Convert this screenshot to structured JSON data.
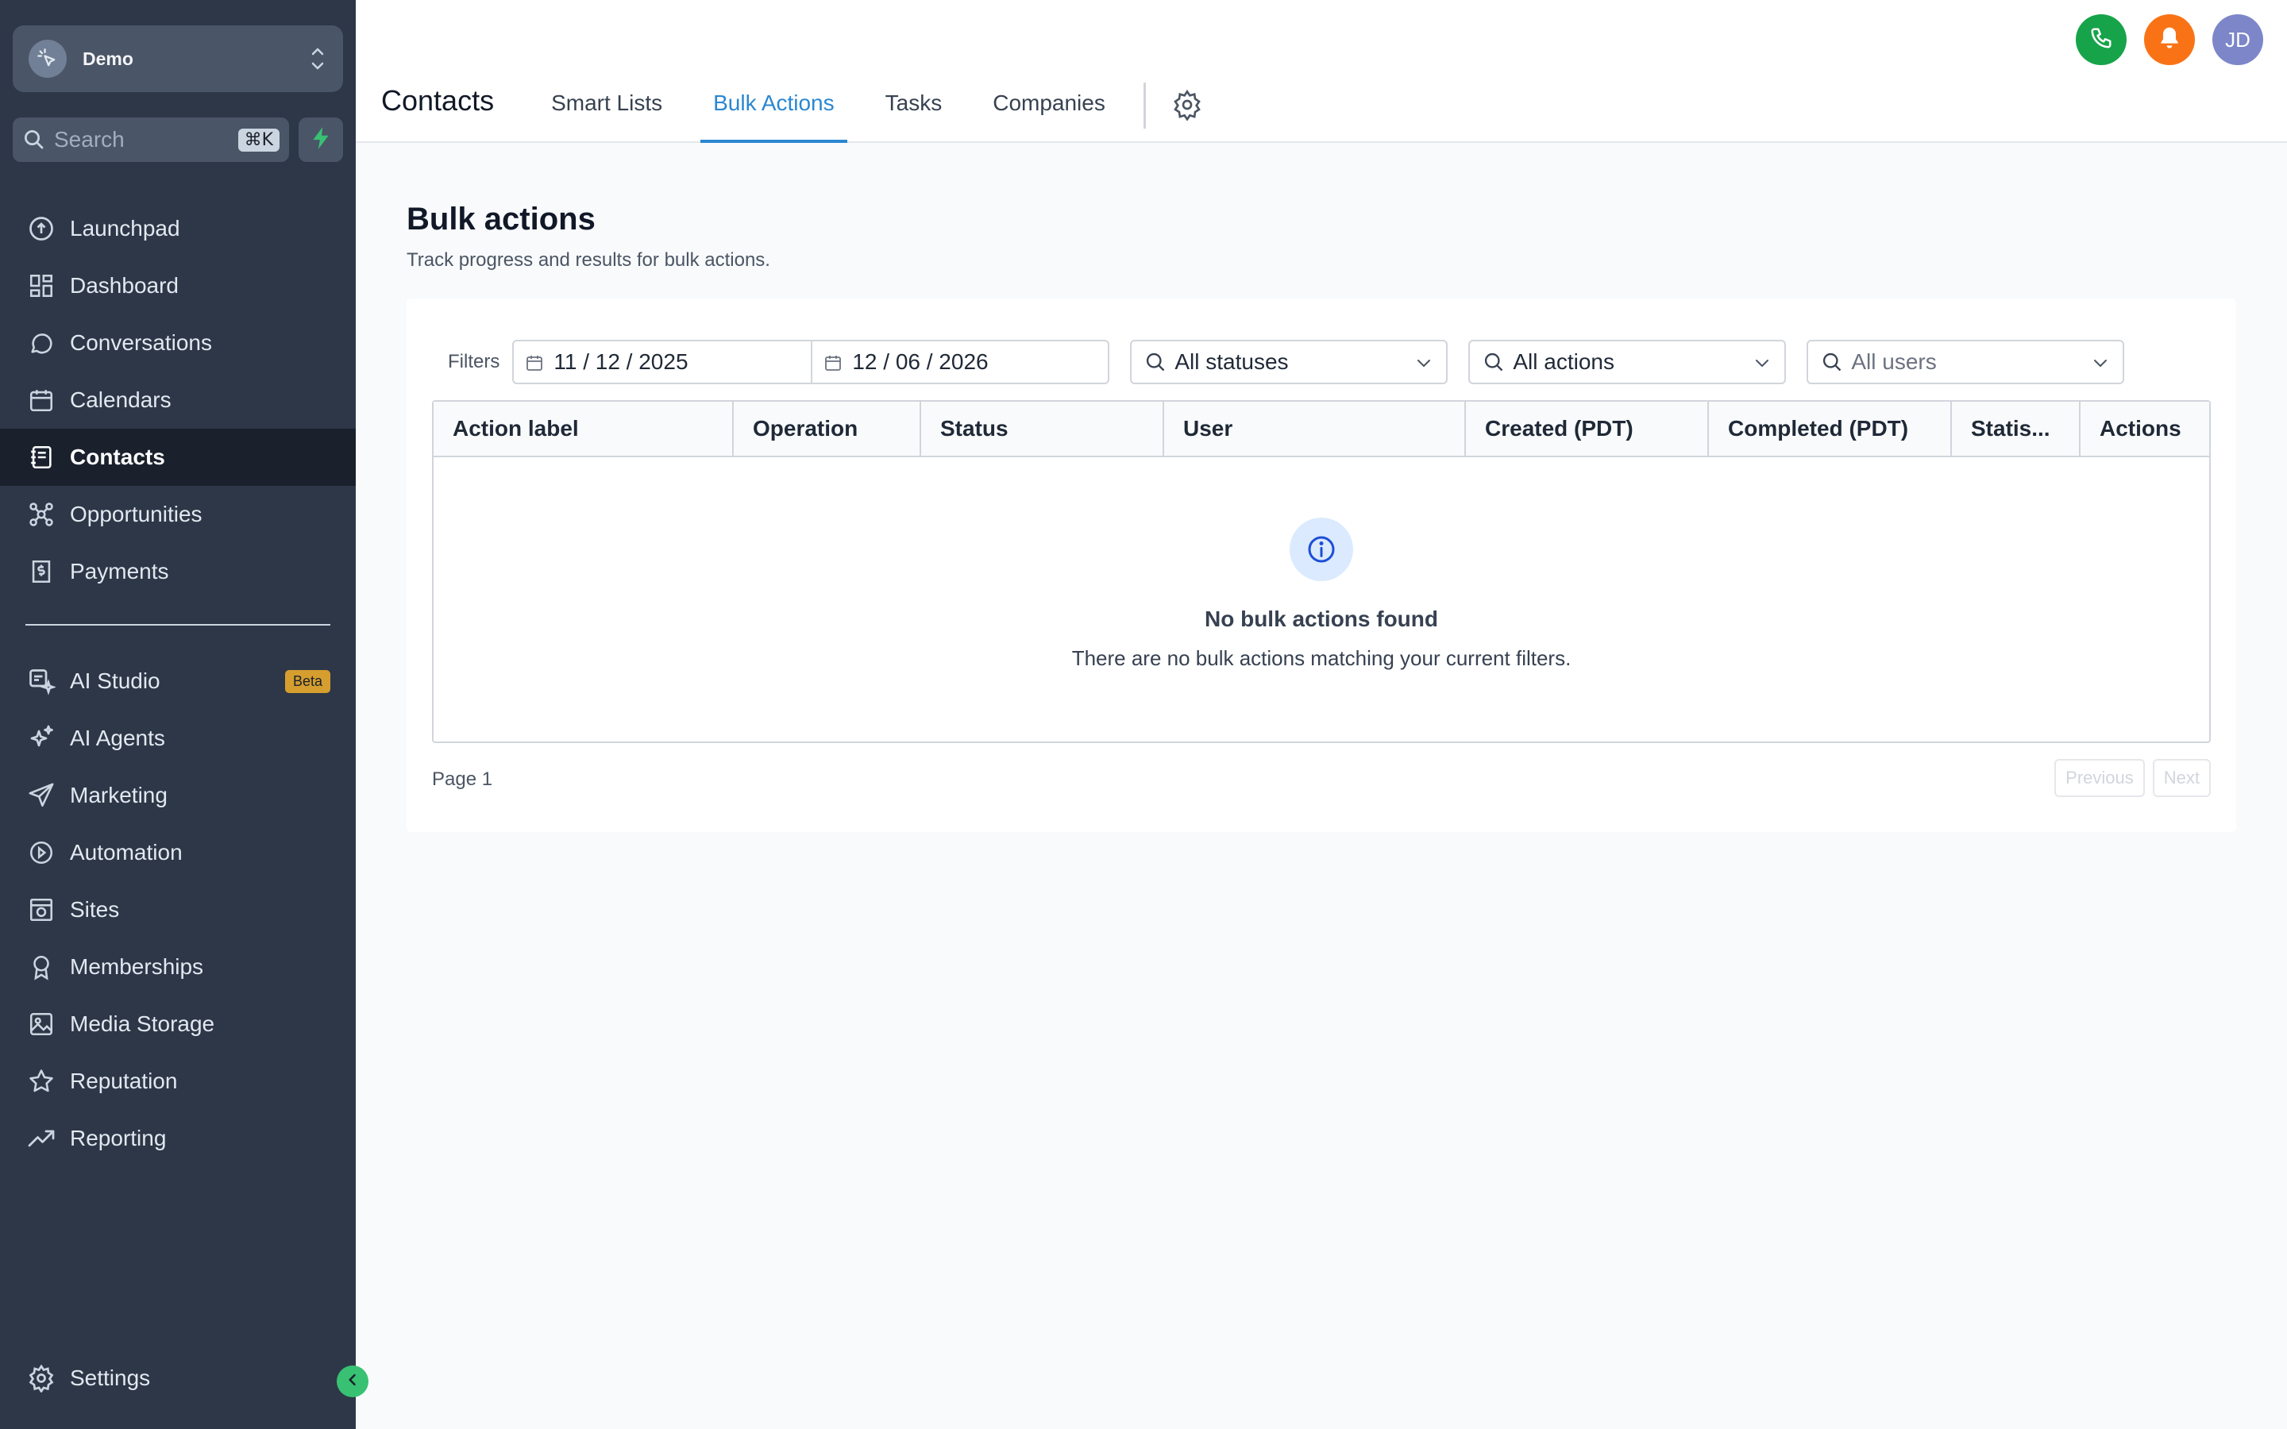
{
  "sidebar": {
    "account": {
      "name": "Demo"
    },
    "search": {
      "placeholder": "Search",
      "shortcut": "⌘K"
    },
    "items_primary": [
      {
        "label": "Launchpad",
        "icon": "launchpad-icon"
      },
      {
        "label": "Dashboard",
        "icon": "dashboard-icon"
      },
      {
        "label": "Conversations",
        "icon": "chat-icon"
      },
      {
        "label": "Calendars",
        "icon": "calendar-icon"
      },
      {
        "label": "Contacts",
        "icon": "contacts-icon",
        "active": true
      },
      {
        "label": "Opportunities",
        "icon": "opportunities-icon"
      },
      {
        "label": "Payments",
        "icon": "payments-icon"
      }
    ],
    "items_secondary": [
      {
        "label": "AI Studio",
        "icon": "ai-studio-icon",
        "badge": "Beta"
      },
      {
        "label": "AI Agents",
        "icon": "sparkle-icon"
      },
      {
        "label": "Marketing",
        "icon": "send-icon"
      },
      {
        "label": "Automation",
        "icon": "automation-icon"
      },
      {
        "label": "Sites",
        "icon": "sites-icon"
      },
      {
        "label": "Memberships",
        "icon": "award-icon"
      },
      {
        "label": "Media Storage",
        "icon": "image-icon"
      },
      {
        "label": "Reputation",
        "icon": "star-icon"
      },
      {
        "label": "Reporting",
        "icon": "trend-icon"
      }
    ],
    "settings": {
      "label": "Settings",
      "icon": "gear-icon"
    }
  },
  "topbar": {
    "title": "Contacts",
    "tabs": [
      {
        "label": "Smart Lists"
      },
      {
        "label": "Bulk Actions",
        "active": true
      },
      {
        "label": "Tasks"
      },
      {
        "label": "Companies"
      }
    ],
    "avatar_initials": "JD",
    "colors": {
      "phone": "#17a34a",
      "bell": "#f97316",
      "avatar": "#7c86c9",
      "accent": "#2b87d1"
    }
  },
  "main": {
    "title": "Bulk actions",
    "subtitle": "Track progress and results for bulk actions.",
    "filters": {
      "label": "Filters",
      "date_from": "11 / 12 / 2025",
      "date_to": "12 / 06 / 2026",
      "status": "All statuses",
      "action": "All actions",
      "user_placeholder": "All users"
    },
    "table": {
      "columns": [
        "Action label",
        "Operation",
        "Status",
        "User",
        "Created (PDT)",
        "Completed (PDT)",
        "Statis...",
        "Actions"
      ],
      "empty_title": "No bulk actions found",
      "empty_desc": "There are no bulk actions matching your current filters."
    },
    "pager": {
      "page_label": "Page 1",
      "previous": "Previous",
      "next": "Next"
    }
  }
}
